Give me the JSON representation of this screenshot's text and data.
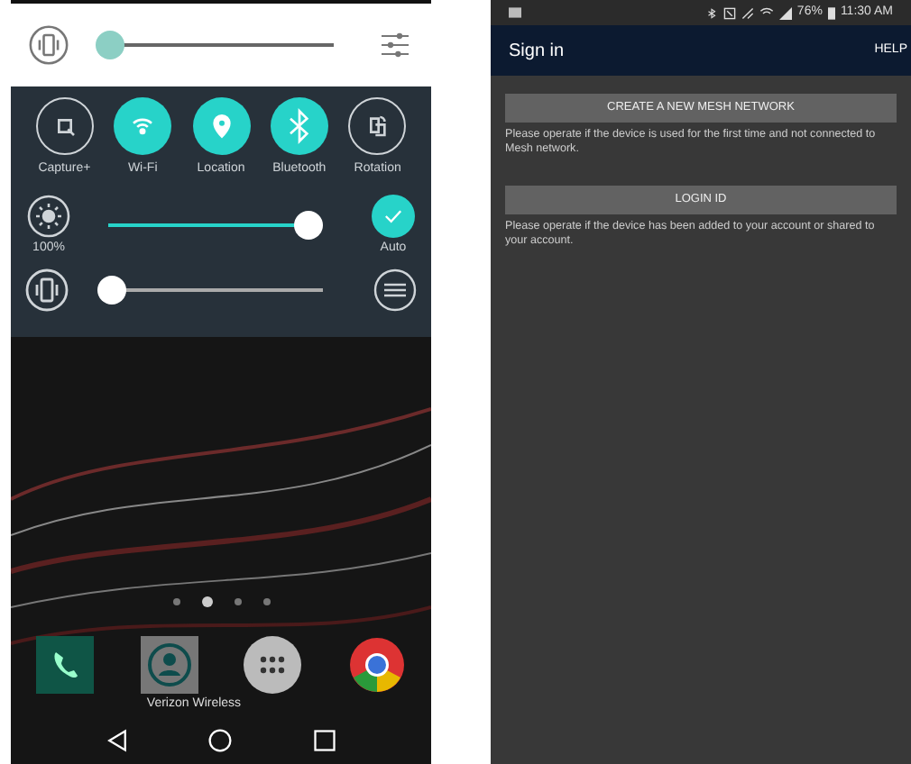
{
  "left_phone": {
    "quick_settings": {
      "top_volume": {
        "level": 0.05
      },
      "toggles": [
        {
          "label": "Capture+",
          "on": false,
          "kind": "capture"
        },
        {
          "label": "Wi-Fi",
          "on": true,
          "kind": "wifi"
        },
        {
          "label": "Location",
          "on": true,
          "kind": "location"
        },
        {
          "label": "Bluetooth",
          "on": true,
          "kind": "bluetooth"
        },
        {
          "label": "Rotation",
          "on": false,
          "kind": "rotation"
        }
      ],
      "brightness": {
        "level": 0.95,
        "reading": "100%",
        "auto_label": "Auto",
        "auto_on": true
      },
      "volume": {
        "level": 0.03
      }
    },
    "page_dots": [
      {
        "selected": false
      },
      {
        "selected": true
      },
      {
        "selected": false
      },
      {
        "selected": false
      }
    ],
    "dock": [
      {
        "kind": "phone"
      },
      {
        "kind": "contacts"
      },
      {
        "kind": "apps"
      },
      {
        "kind": "browser"
      }
    ],
    "carrier": "Verizon Wireless"
  },
  "right_phone": {
    "status_bar": {
      "battery": "76%",
      "time": "11:30 AM"
    },
    "app_bar": {
      "title": "Sign in",
      "action": "HELP"
    },
    "options": [
      {
        "button": "CREATE A NEW MESH NETWORK",
        "description": "Please operate if the device is used for the first time and not connected to Mesh network."
      },
      {
        "button": "LOGIN ID",
        "description": "Please operate if the device has been added to your account or shared to your account."
      }
    ]
  }
}
